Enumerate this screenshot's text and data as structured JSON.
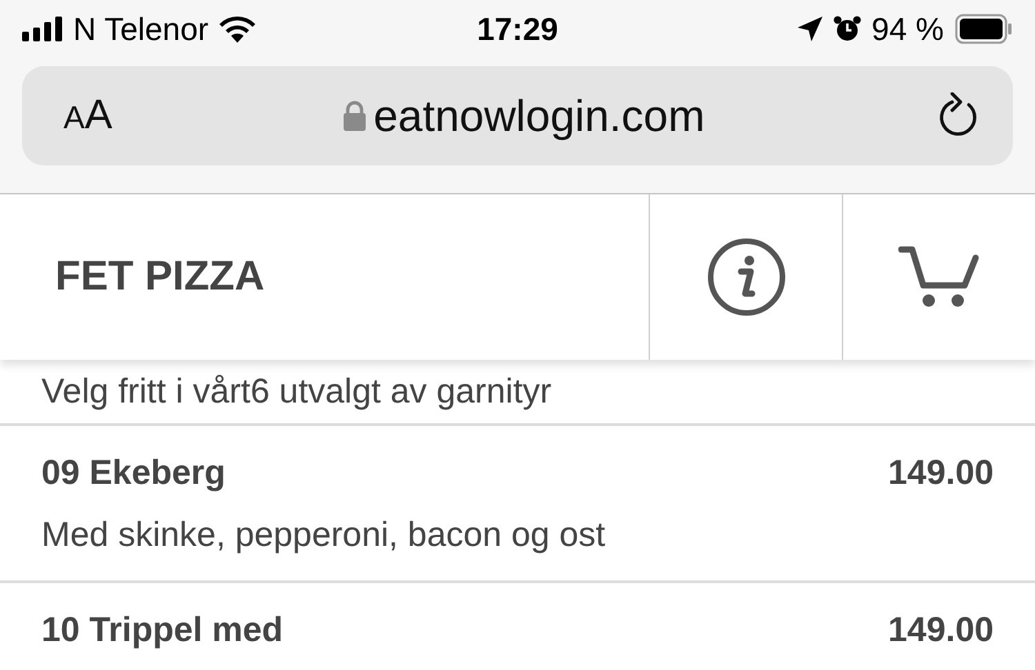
{
  "status_bar": {
    "carrier": "N Telenor",
    "time": "17:29",
    "battery": "94 %"
  },
  "address_bar": {
    "text_size": "AA",
    "url": "eatnowlogin.com"
  },
  "header": {
    "title": "FET PIZZA"
  },
  "intro": "Velg fritt i vårt6 utvalgt av garnityr",
  "menu_items": [
    {
      "name": "09 Ekeberg",
      "price": "149.00",
      "description": "Med skinke, pepperoni, bacon og ost"
    },
    {
      "name": "10 Trippel med",
      "price": "149.00"
    }
  ]
}
